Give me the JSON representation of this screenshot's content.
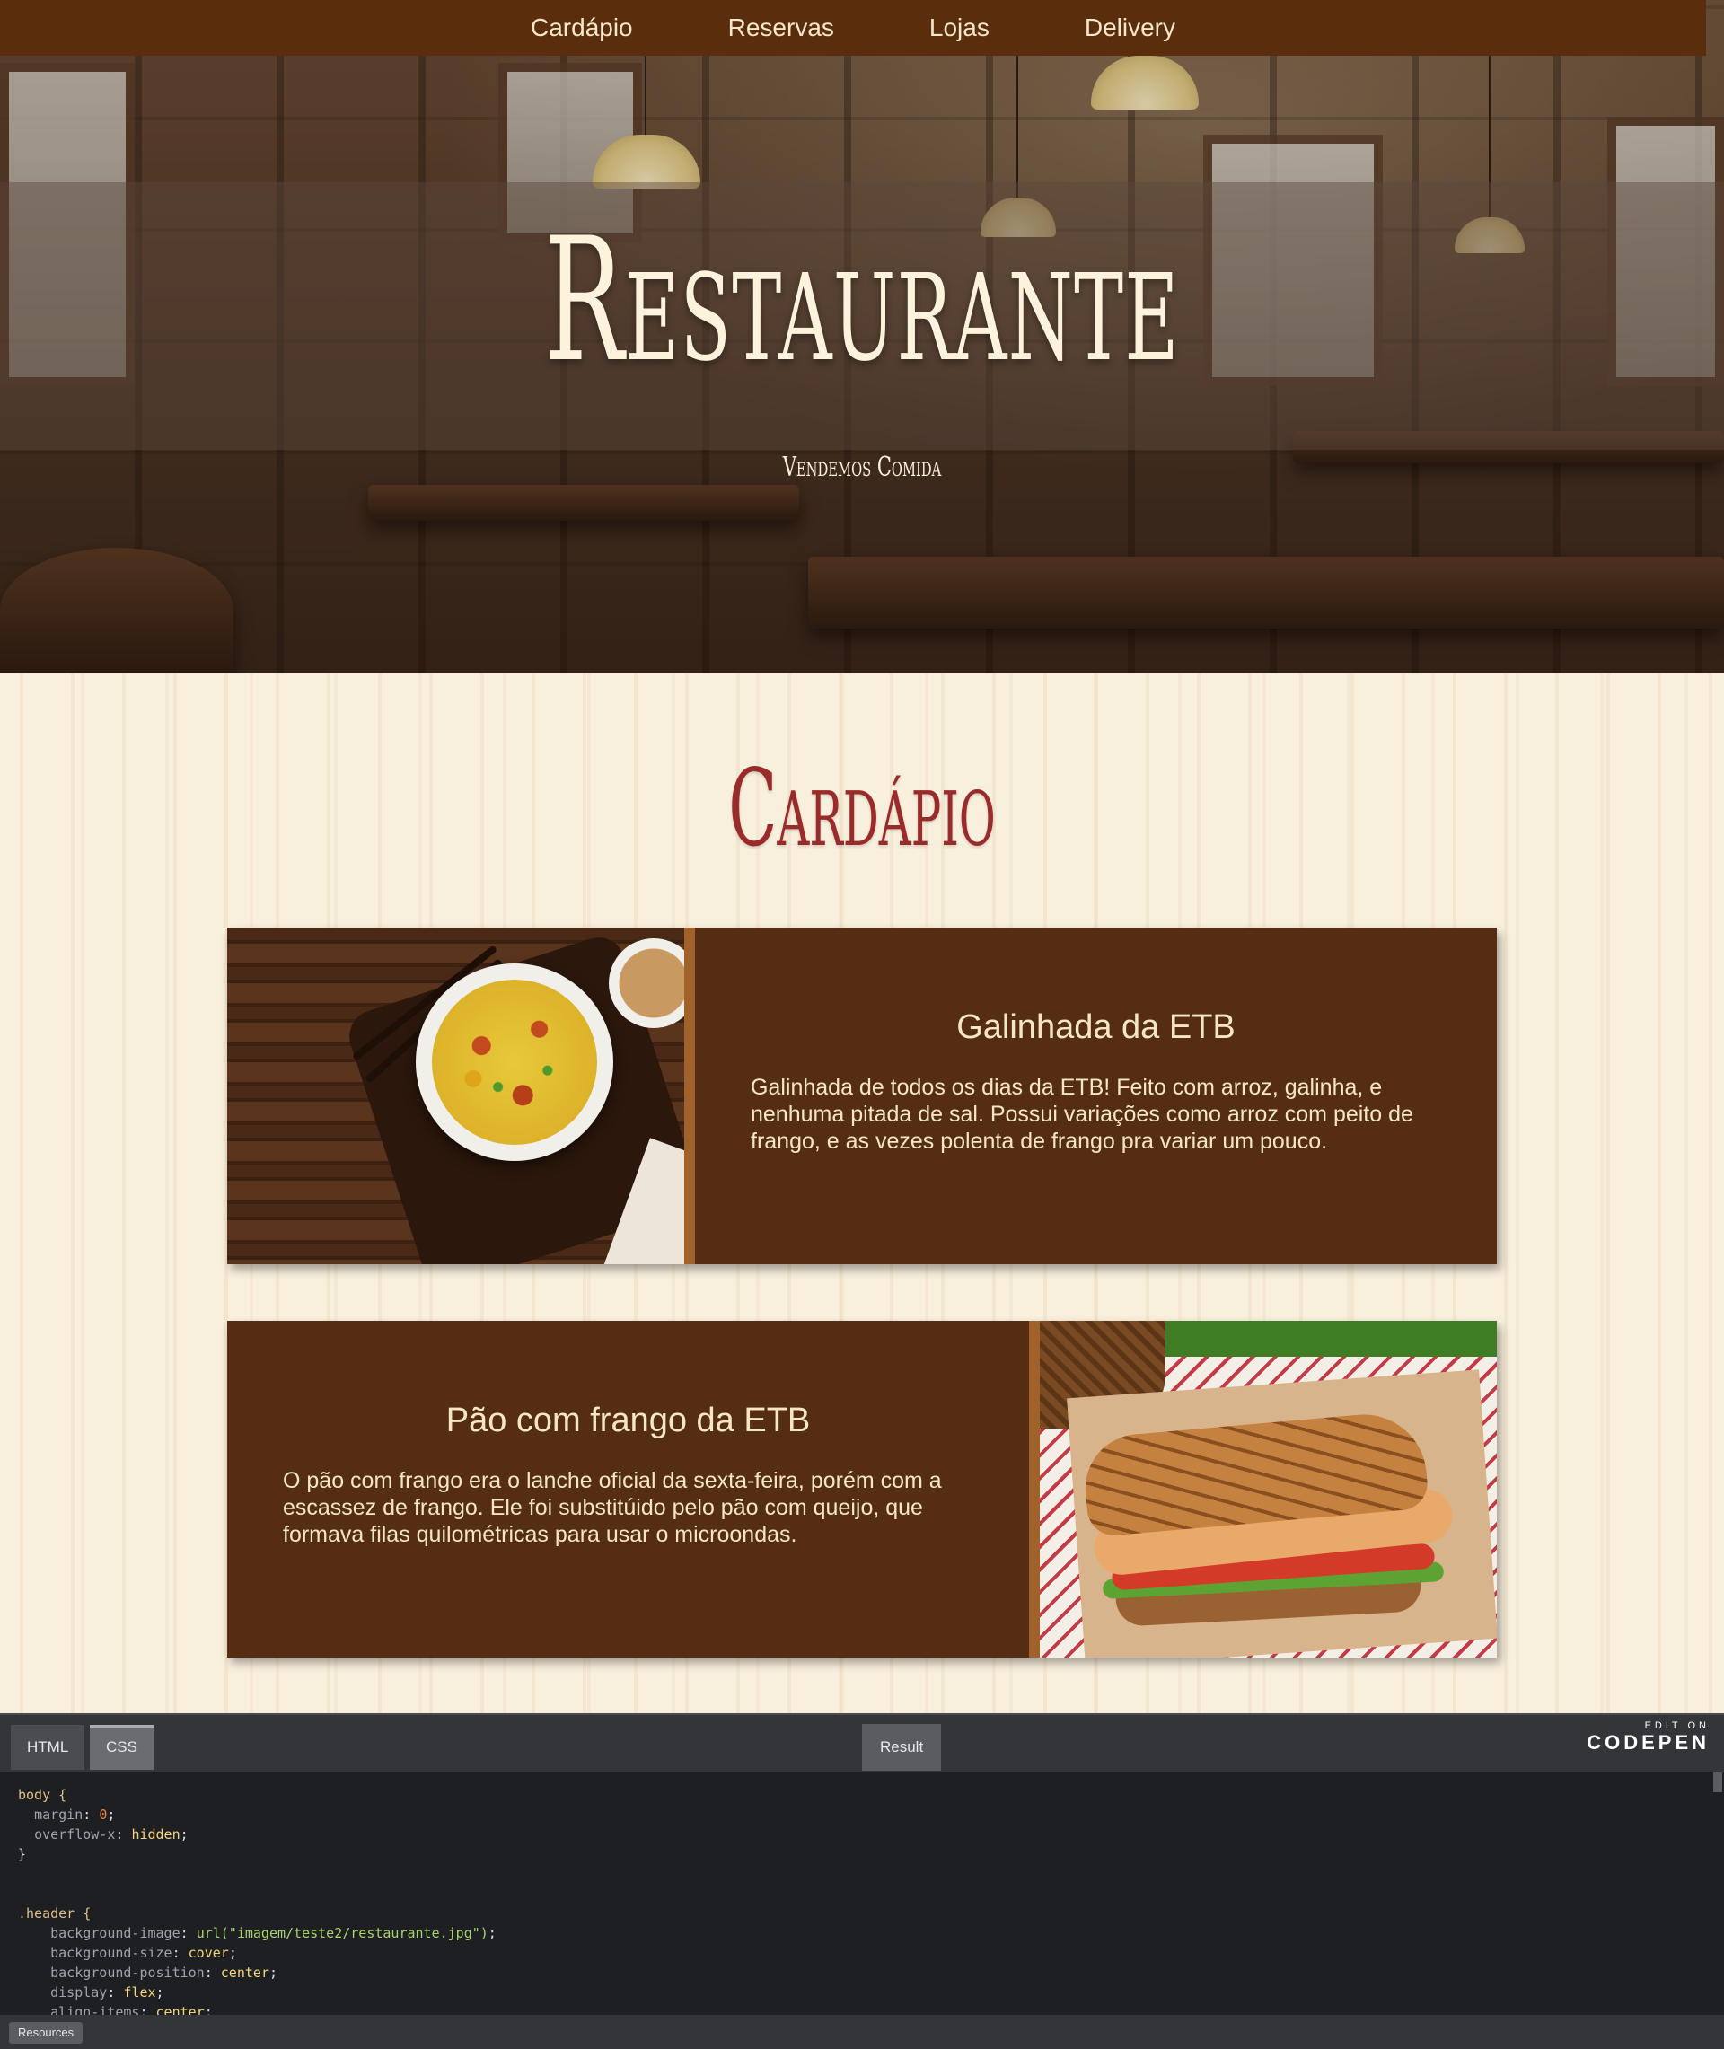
{
  "nav": {
    "items": [
      "Cardápio",
      "Reservas",
      "Lojas",
      "Delivery"
    ]
  },
  "hero": {
    "title": "Restaurante",
    "subtitle": "Vendemos Comida"
  },
  "menu": {
    "title": "Cardápio",
    "items": [
      {
        "name": "Galinhada da ETB",
        "description": "Galinhada de todos os dias da ETB! Feito com arroz, galinha, e nenhuma pitada de sal. Possui variações como arroz com peito de frango, e as vezes polenta de frango pra variar um pouco.",
        "image": "rice-bowl-photo"
      },
      {
        "name": "Pão com frango da ETB",
        "description": "O pão com frango era o lanche oficial da sexta-feira, porém com a escassez de frango. Ele foi substitúido pelo pão com queijo, que formava filas quilométricas para usar o microondas.",
        "image": "chicken-sandwich-photo"
      }
    ]
  },
  "codepen": {
    "tabs": [
      "HTML",
      "CSS"
    ],
    "active_tab": "CSS",
    "result_label": "Result",
    "brand_top": "EDIT ON",
    "brand_logo": "CODEPEN",
    "resources_label": "Resources",
    "code": {
      "l1": "body {",
      "l2_prop": "margin",
      "l2_val": "0",
      "l3_prop": "overflow-x",
      "l3_val": "hidden",
      "l4": "}",
      "l5": ".header {",
      "l6_prop": "background-image",
      "l6_val": "url(\"imagem/teste2/restaurante.jpg\")",
      "l7_prop": "background-size",
      "l7_val": "cover",
      "l8_prop": "background-position",
      "l8_val": "center",
      "l9_prop": "display",
      "l9_val": "flex",
      "l10_prop": "align-items",
      "l10_val": "center"
    }
  },
  "colors": {
    "nav_bg": "#5a2d0c",
    "card_bg": "#542d12",
    "title_red": "#9a2b2b",
    "cream": "#f6e6c4"
  }
}
